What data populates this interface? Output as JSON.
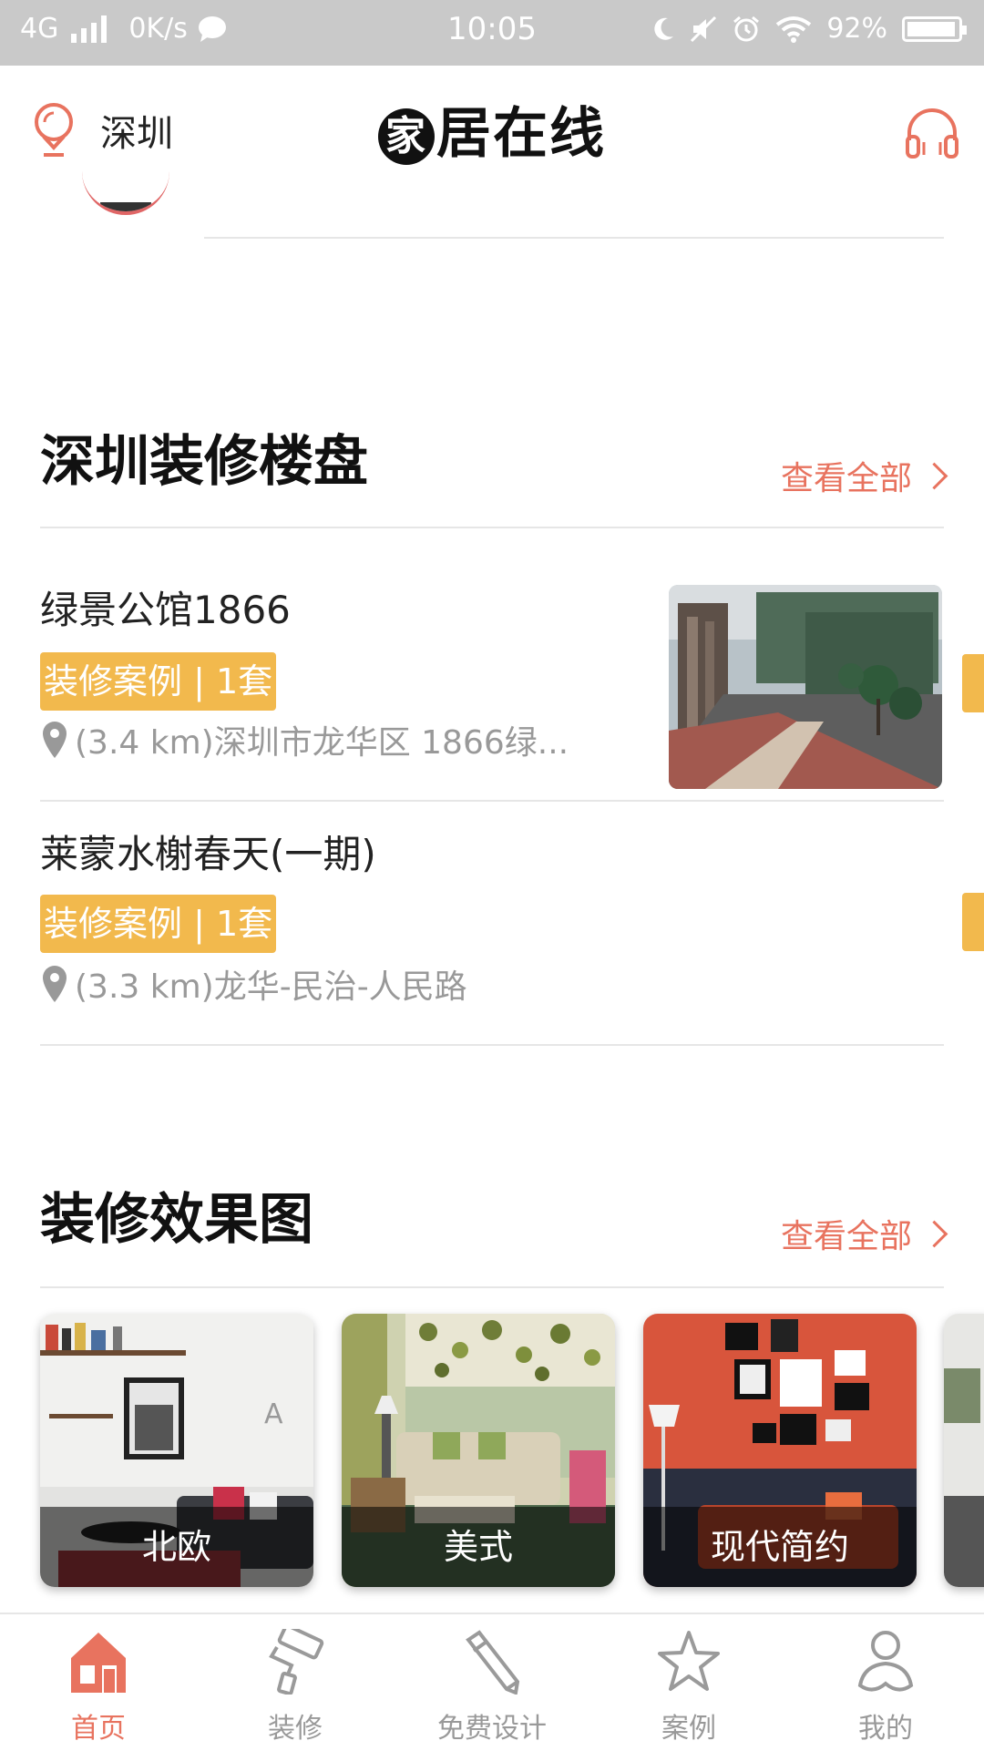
{
  "status_bar": {
    "network": "4G",
    "speed": "0K/s",
    "time": "10:05",
    "battery": "92%"
  },
  "header": {
    "city": "深圳",
    "logo_glyph": "家",
    "logo_text": "居在线"
  },
  "section_properties": {
    "title": "深圳装修楼盘",
    "view_all": "查看全部",
    "items": [
      {
        "name": "绿景公馆1866",
        "tag": "装修案例 | 1套",
        "address": "(3.4 km)深圳市龙华区 1866绿..."
      },
      {
        "name": "莱蒙水榭春天(一期)",
        "tag": "装修案例 | 1套",
        "address": "(3.3 km)龙华-民治-人民路"
      }
    ]
  },
  "section_styles": {
    "title": "装修效果图",
    "view_all": "查看全部",
    "cards": [
      {
        "label": "北欧"
      },
      {
        "label": "美式"
      },
      {
        "label": "现代简约"
      }
    ]
  },
  "tabs": [
    {
      "label": "首页",
      "icon": "home-icon",
      "active": true
    },
    {
      "label": "装修",
      "icon": "paint-roller-icon"
    },
    {
      "label": "免费设计",
      "icon": "pencil-icon"
    },
    {
      "label": "案例",
      "icon": "star-icon"
    },
    {
      "label": "我的",
      "icon": "user-icon"
    }
  ],
  "colors": {
    "accent": "#e8735f",
    "tag": "#f2b94d",
    "status_bar": "#c9c9c9"
  }
}
